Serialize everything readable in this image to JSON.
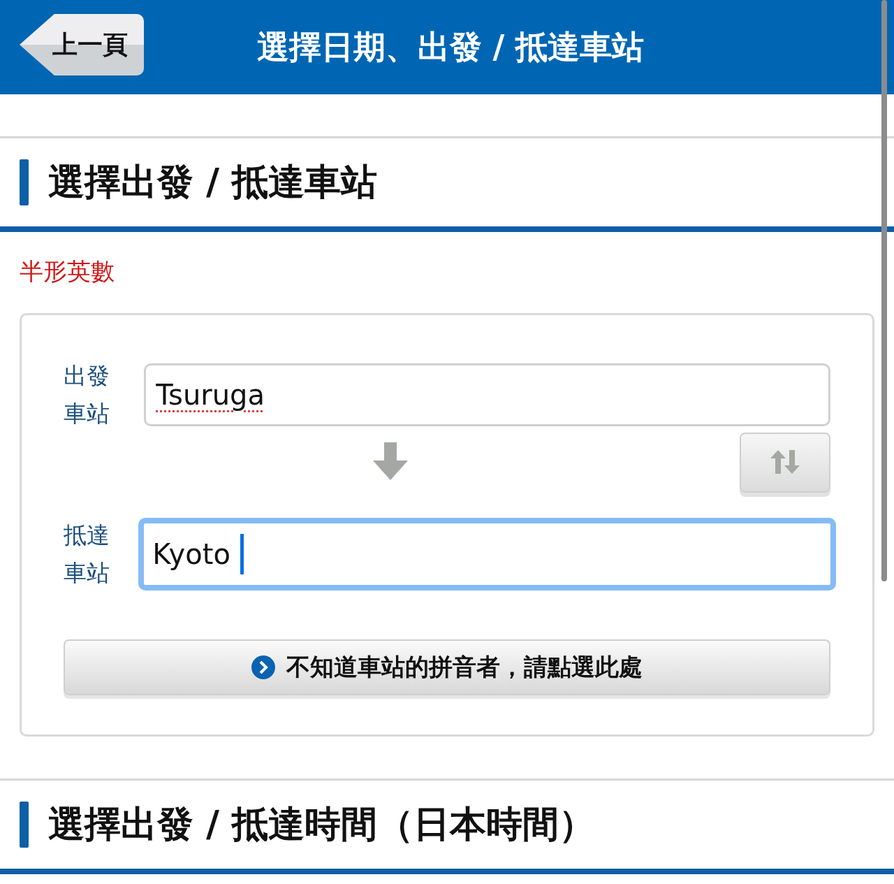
{
  "header": {
    "back_button": "上一頁",
    "title": "選擇日期、出發 / 抵達車站"
  },
  "sections": [
    {
      "title": "選擇出發 / 抵達車站",
      "note": "半形英數",
      "fields": [
        {
          "label": "出發車站",
          "value": "Tsuruga",
          "focused": false,
          "misspelled": true
        },
        {
          "label": "抵達車站",
          "value": "Kyoto",
          "focused": true,
          "misspelled": false
        }
      ],
      "help_button": "不知道車站的拼音者，請點選此處"
    },
    {
      "title": "選擇出發 / 抵達時間（日本時間）"
    }
  ]
}
